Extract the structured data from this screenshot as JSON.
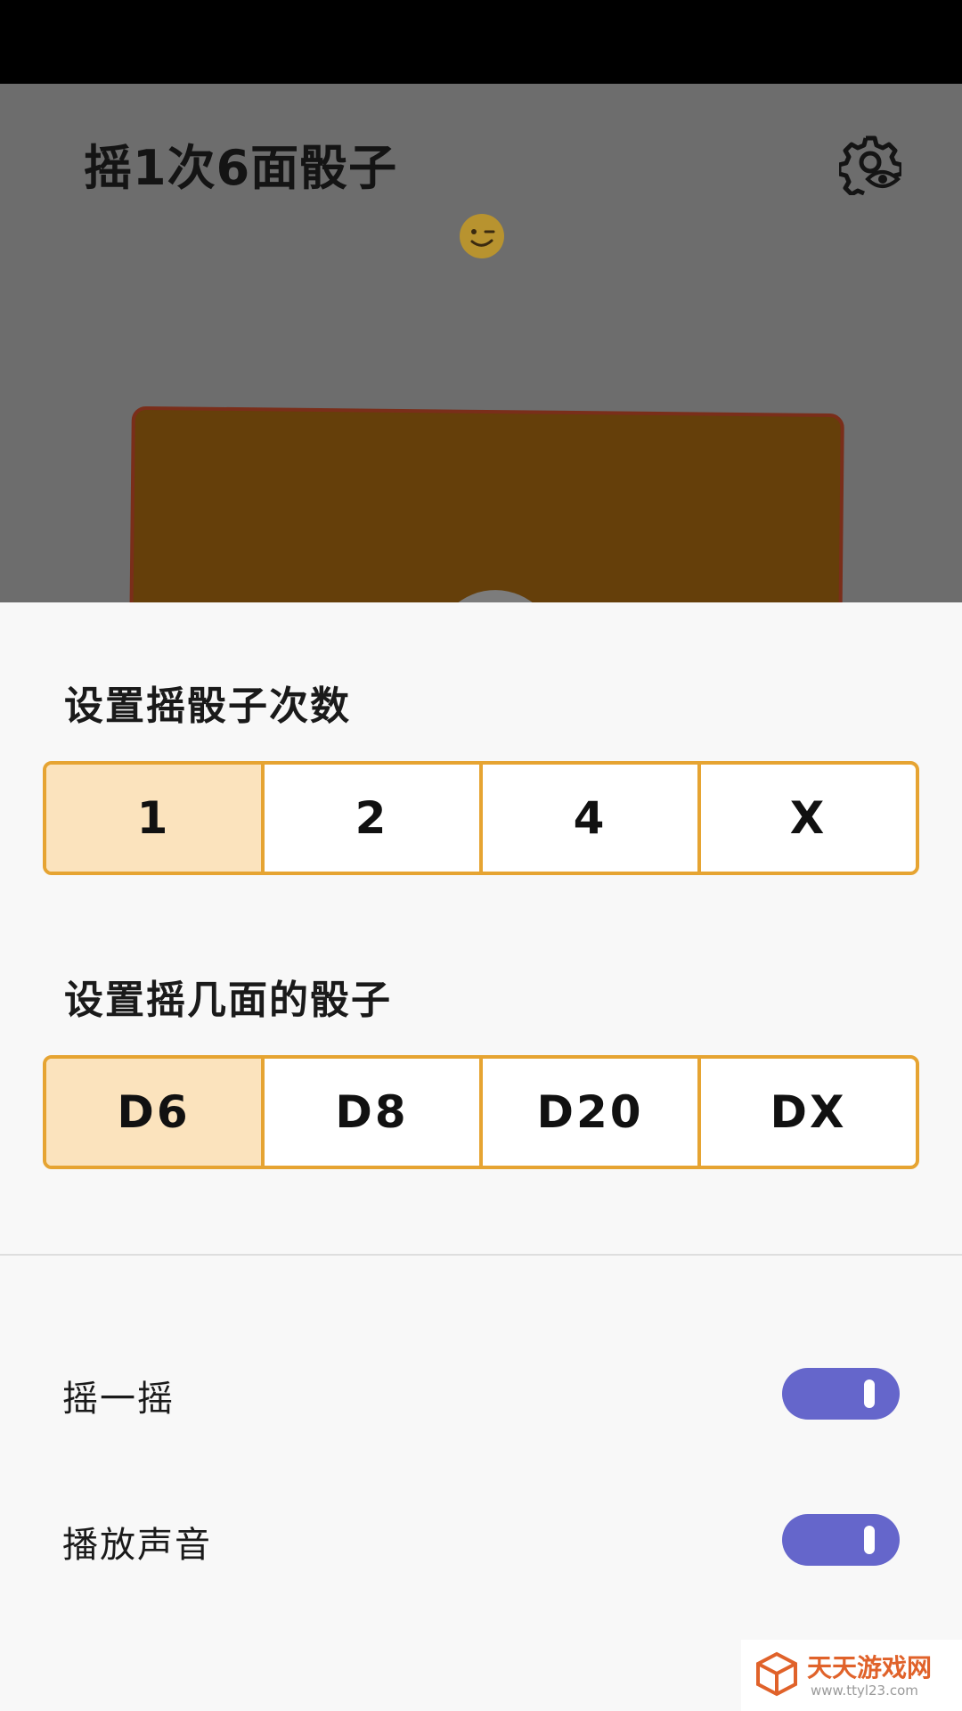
{
  "app": {
    "title": "摇1次6面骰子"
  },
  "icons": {
    "settings": "gear-eye-icon",
    "emoji": "winking-face-icon",
    "watermark_logo": "cube-logo-icon"
  },
  "colors": {
    "accent_border": "#e6a432",
    "selected_fill": "#fbe3bd",
    "switch_on": "#6566cb",
    "dice_card": "#653f0a",
    "overlay_dim": "#6d6d6d"
  },
  "roll_count": {
    "title": "设置摇骰子次数",
    "options": [
      "1",
      "2",
      "4",
      "X"
    ],
    "selected": "1"
  },
  "dice_type": {
    "title": "设置摇几面的骰子",
    "options": [
      "D6",
      "D8",
      "D20",
      "DX"
    ],
    "selected": "D6"
  },
  "toggles": [
    {
      "label": "摇一摇",
      "on": true
    },
    {
      "label": "播放声音",
      "on": true
    }
  ],
  "watermark": {
    "name": "天天游戏网",
    "url": "www.ttyl23.com"
  }
}
